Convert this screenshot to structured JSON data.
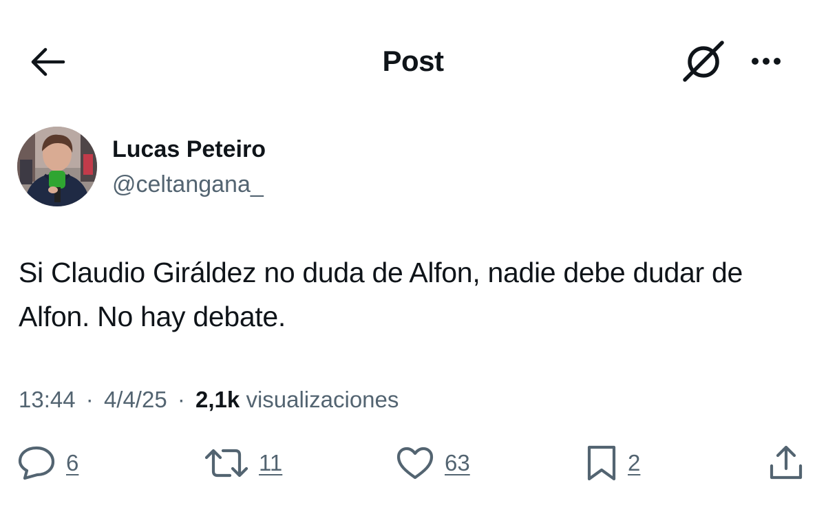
{
  "header": {
    "title": "Post"
  },
  "icons": {
    "back": "arrow-left-icon",
    "grok": "grok-icon",
    "more": "more-horizontal-icon",
    "reply": "reply-icon",
    "repost": "repost-icon",
    "like": "heart-icon",
    "bookmark": "bookmark-icon",
    "share": "share-icon"
  },
  "author": {
    "display_name": "Lucas Peteiro",
    "handle": "@celtangana_"
  },
  "post": {
    "text": "Si Claudio Giráldez no duda de Alfon, nadie debe dudar de Alfon. No hay debate.",
    "time": "13:44",
    "separator": "·",
    "date": "4/4/25",
    "views_count": "2,1k",
    "views_label": "visualizaciones"
  },
  "actions": {
    "replies": "6",
    "reposts": "11",
    "likes": "63",
    "bookmarks": "2"
  },
  "colors": {
    "text_primary": "#0f1419",
    "text_secondary": "#536471",
    "background": "#ffffff"
  }
}
